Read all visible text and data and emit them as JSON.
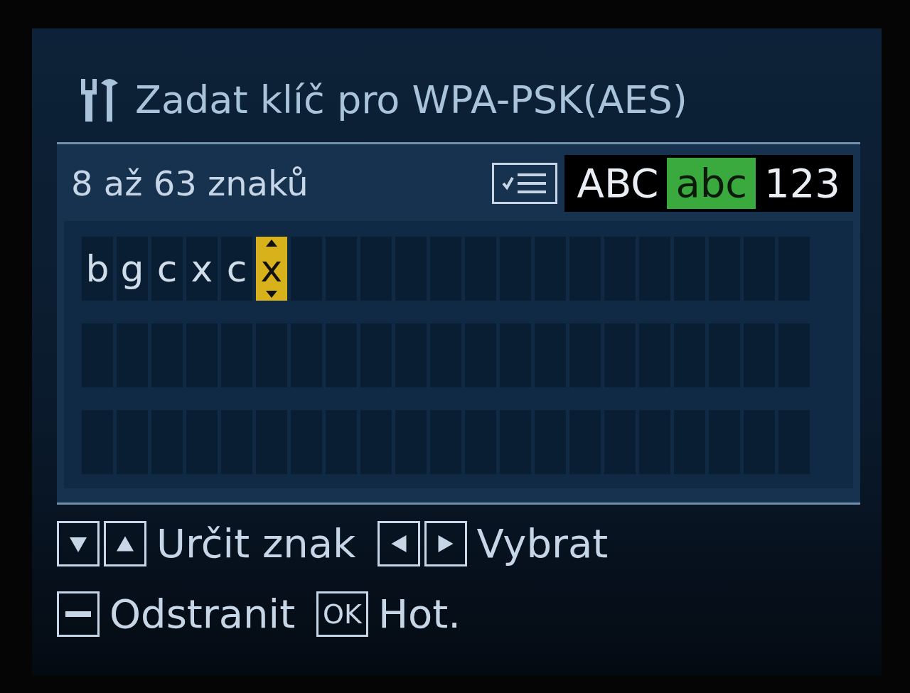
{
  "title": "Zadat klíč pro WPA-PSK(AES)",
  "range_label": "8 až 63 znaků",
  "modes": [
    {
      "label": "ABC",
      "selected": false
    },
    {
      "label": "abc",
      "selected": true
    },
    {
      "label": "123",
      "selected": false
    }
  ],
  "entered": [
    {
      "char": "b",
      "cursor": false
    },
    {
      "char": "g",
      "cursor": false
    },
    {
      "char": "c",
      "cursor": false
    },
    {
      "char": "x",
      "cursor": false
    },
    {
      "char": "c",
      "cursor": false
    },
    {
      "char": "x",
      "cursor": true
    }
  ],
  "hints": [
    [
      {
        "keys": [
          {
            "kind": "down"
          },
          {
            "kind": "up"
          }
        ],
        "label": "Určit znak"
      },
      {
        "keys": [
          {
            "kind": "left"
          },
          {
            "kind": "right"
          }
        ],
        "label": "Vybrat"
      }
    ],
    [
      {
        "keys": [
          {
            "kind": "minus"
          }
        ],
        "label": "Odstranit"
      },
      {
        "keys": [
          {
            "kind": "text",
            "text": "OK"
          }
        ],
        "label": "Hot."
      }
    ]
  ]
}
